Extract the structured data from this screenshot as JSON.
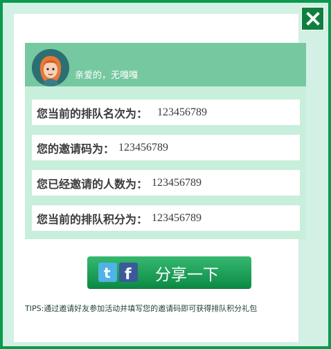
{
  "greeting": "亲爱的，无嘎嘎",
  "rows": [
    {
      "label": "您当前的排队名次为：",
      "value": "123456789"
    },
    {
      "label": "您的邀请码为：",
      "value": "123456789"
    },
    {
      "label": "您已经邀请的人数为：",
      "value": "123456789"
    },
    {
      "label": "您当前的排队积分为：",
      "value": "123456789"
    }
  ],
  "share": {
    "label": "分享一下",
    "icons": [
      "twitter-icon",
      "facebook-icon"
    ]
  },
  "tips": "TIPS:通过邀请好友参加活动并填写您的邀请码即可获得排队积分礼包",
  "close": {
    "icon": "close-icon"
  },
  "colors": {
    "frame": "#0a9a4f",
    "mint": "#d2f0e3",
    "header": "#76c8a1",
    "panel": "#c8eedc",
    "button": "#1ea45a"
  }
}
